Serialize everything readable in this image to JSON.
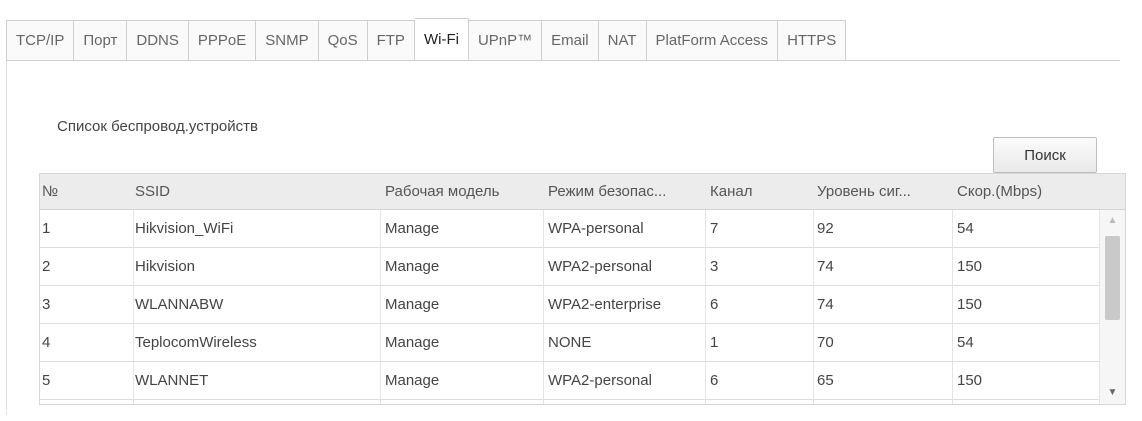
{
  "tabs": [
    {
      "label": "TCP/IP",
      "active": false
    },
    {
      "label": "Порт",
      "active": false
    },
    {
      "label": "DDNS",
      "active": false
    },
    {
      "label": "PPPoE",
      "active": false
    },
    {
      "label": "SNMP",
      "active": false
    },
    {
      "label": "QoS",
      "active": false
    },
    {
      "label": "FTP",
      "active": false
    },
    {
      "label": "Wi-Fi",
      "active": true
    },
    {
      "label": "UPnP™",
      "active": false
    },
    {
      "label": "Email",
      "active": false
    },
    {
      "label": "NAT",
      "active": false
    },
    {
      "label": "PlatForm Access",
      "active": false
    },
    {
      "label": "HTTPS",
      "active": false
    }
  ],
  "device_list": {
    "title": "Список беспровод.устройств",
    "search_label": "Поиск",
    "columns": [
      "№",
      "SSID",
      "Рабочая модель",
      "Режим безопас...",
      "Канал",
      "Уровень сиг...",
      "Скор.(Mbps)"
    ],
    "rows": [
      [
        "1",
        "Hikvision_WiFi",
        "Manage",
        "WPA-personal",
        "7",
        "92",
        "54"
      ],
      [
        "2",
        "Hikvision",
        "Manage",
        "WPA2-personal",
        "3",
        "74",
        "150"
      ],
      [
        "3",
        "WLANNABW",
        "Manage",
        "WPA2-enterprise",
        "6",
        "74",
        "150"
      ],
      [
        "4",
        "TeplocomWireless",
        "Manage",
        "NONE",
        "1",
        "70",
        "54"
      ],
      [
        "5",
        "WLANNET",
        "Manage",
        "WPA2-personal",
        "6",
        "65",
        "150"
      ]
    ]
  },
  "icons": {
    "scroll_up": "triangle-up",
    "scroll_down": "triangle-down"
  }
}
